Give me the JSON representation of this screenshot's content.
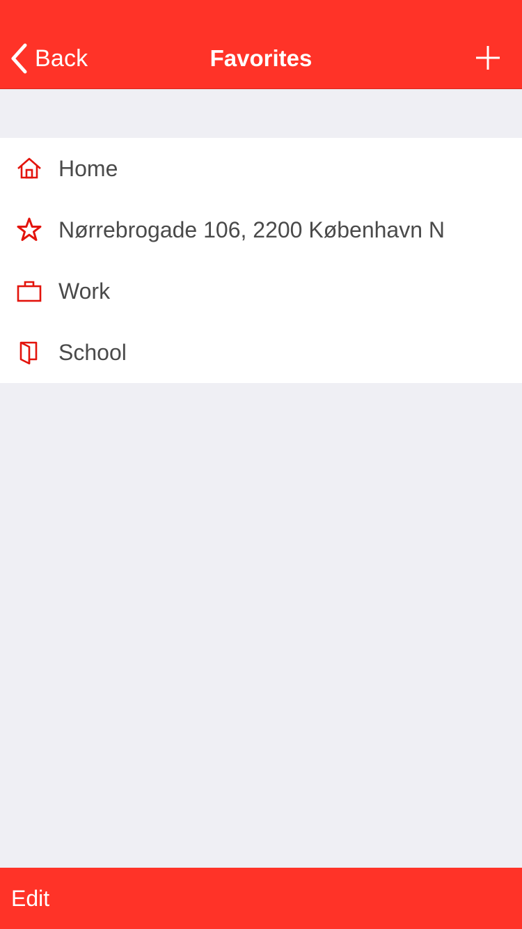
{
  "colors": {
    "accent": "#ff3328",
    "background": "#efeff4",
    "list_bg": "#ffffff",
    "text": "#4a4a4a",
    "icon": "#e3130b"
  },
  "nav": {
    "back_label": "Back",
    "title": "Favorites",
    "add_icon": "plus-icon",
    "back_icon": "chevron-left-icon"
  },
  "favorites": [
    {
      "icon": "home-icon",
      "label": "Home"
    },
    {
      "icon": "star-icon",
      "label": "Nørrebrogade 106, 2200 København N"
    },
    {
      "icon": "briefcase-icon",
      "label": "Work"
    },
    {
      "icon": "book-icon",
      "label": "School"
    }
  ],
  "toolbar": {
    "edit_label": "Edit"
  }
}
